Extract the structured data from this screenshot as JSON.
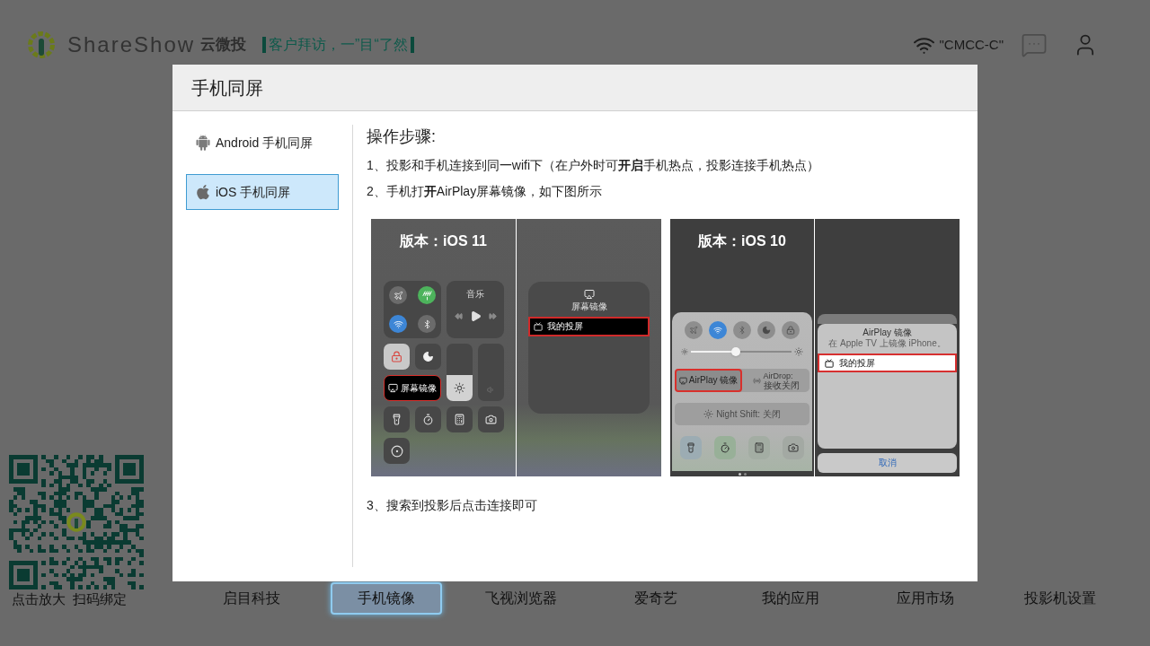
{
  "header": {
    "brand": "ShareShow",
    "brand_cn": "云微投",
    "slogan": "客户拜访，一”目“了然",
    "wifi_name": "\"CMCC-C\""
  },
  "modal": {
    "title": "手机同屏",
    "nav": [
      {
        "kind": "android",
        "label": "Android 手机同屏",
        "selected": false
      },
      {
        "kind": "ios",
        "label": "iOS 手机同屏",
        "selected": true
      }
    ],
    "heading": "操作步骤:",
    "steps_before": [
      "1、投影和手机连接到同一wifi下（在户外时可**开启**手机热点，投影连接手机热点）",
      "2、手机打**开**AirPlay屏幕镜像，如下图所示"
    ],
    "figures": [
      {
        "kind": "ios11",
        "version": "版本：iOS 11",
        "music": "音乐",
        "brightness": {
          "level": 0.46
        },
        "mirror_button": "屏幕镜像",
        "menu_title": "屏幕镜像",
        "device": "我的投屏"
      },
      {
        "kind": "ios10",
        "version": "版本：iOS 10",
        "brightness": {
          "level": 0.45
        },
        "airplay_button": "AirPlay 镜像",
        "airdrop_label": "AirDrop:",
        "airdrop_state": "接收关闭",
        "night_shift": "Night Shift: 关闭",
        "dialog_title": "AirPlay 镜像",
        "dialog_subtitle": "在 Apple TV 上镜像 iPhone。",
        "device": "我的投屏",
        "cancel": "取消"
      }
    ],
    "steps_after": [
      "3、搜索到投影后点击连接即可"
    ]
  },
  "qr": {
    "caption": "点击放大  扫码绑定"
  },
  "dock": [
    {
      "label": "启目科技",
      "selected": false
    },
    {
      "label": "手机镜像",
      "selected": true
    },
    {
      "label": "飞视浏览器",
      "selected": false
    },
    {
      "label": "爱奇艺",
      "selected": false
    },
    {
      "label": "我的应用",
      "selected": false
    },
    {
      "label": "应用市场",
      "selected": false
    },
    {
      "label": "投影机设置",
      "selected": false
    }
  ]
}
